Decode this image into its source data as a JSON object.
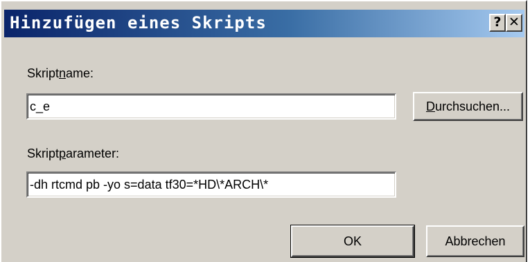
{
  "window": {
    "title": "Hinzufügen eines Skripts",
    "help_label": "?",
    "close_label": "✕"
  },
  "form": {
    "script_name": {
      "label_pre": "Skript",
      "label_accel": "n",
      "label_post": "ame:",
      "value": "c_e"
    },
    "browse_button": {
      "accel": "D",
      "label_rest": "urchsuchen..."
    },
    "script_params": {
      "label_pre": "Skript",
      "label_accel": "p",
      "label_post": "arameter:",
      "value": "-dh rtcmd pb -yo s=data tf30=*HD\\*ARCH\\*"
    }
  },
  "footer": {
    "ok_label": "OK",
    "cancel_label": "Abbrechen"
  }
}
